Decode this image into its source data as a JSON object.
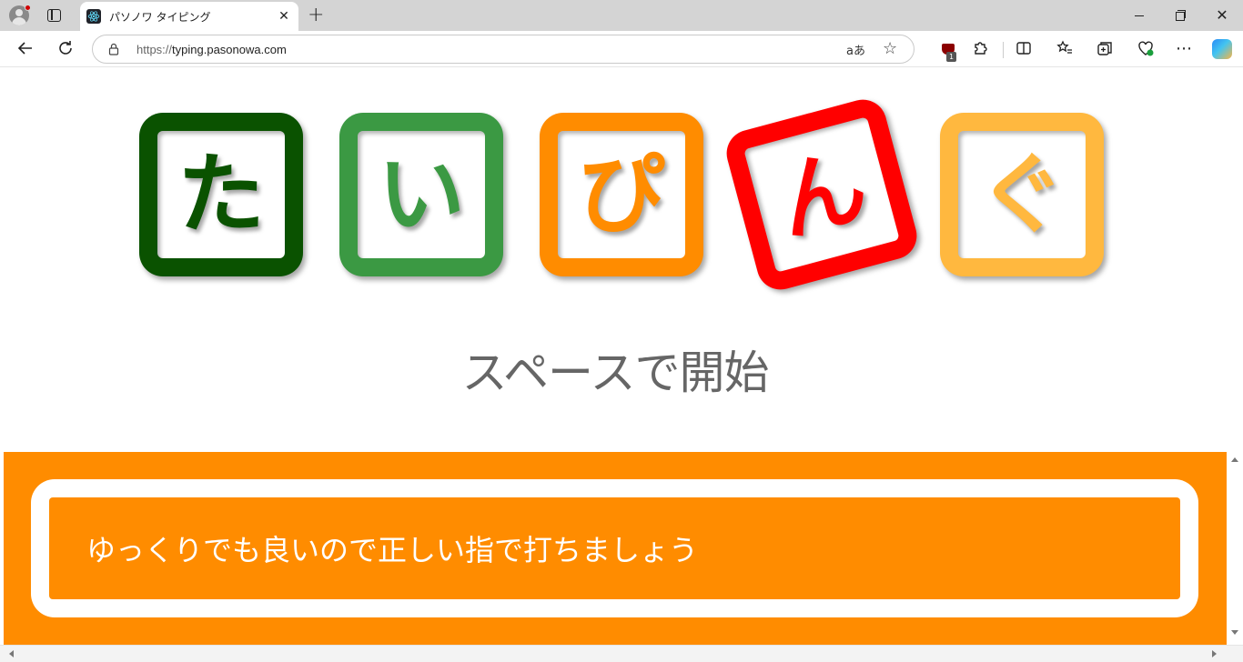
{
  "browser": {
    "tab_title": "パソノワ タイピング",
    "url_scheme": "https://",
    "url_host": "typing.pasonowa.com",
    "read_aloud_label": "aあ",
    "extension_badge_count": "1"
  },
  "logo": {
    "letters": [
      "た",
      "い",
      "ぴ",
      "ん",
      "ぐ"
    ],
    "colors": [
      "#0a5200",
      "#3b9943",
      "#ff8c00",
      "#ff0000",
      "#ffb83f"
    ]
  },
  "main": {
    "start_prompt": "スペースで開始",
    "tip_text": "ゆっくりでも良いので正しい指で打ちましょう"
  },
  "theme": {
    "accent": "#ff8c00",
    "text_gray": "#666666"
  }
}
